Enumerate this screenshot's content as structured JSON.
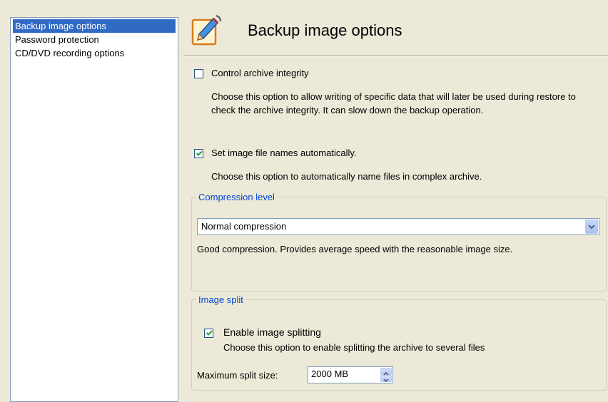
{
  "sidebar": {
    "items": [
      {
        "label": "Backup image options",
        "selected": true
      },
      {
        "label": "Password protection",
        "selected": false
      },
      {
        "label": "CD/DVD recording options",
        "selected": false
      }
    ]
  },
  "header": {
    "title": "Backup image options",
    "icon": "pencil-edit-icon"
  },
  "options": {
    "integrity": {
      "label": "Control archive integrity",
      "checked": false,
      "description": "Choose this option to allow writing of specific data that will later be used during restore to check the archive integrity. It can slow down the backup operation."
    },
    "auto_names": {
      "label": "Set image file names automatically.",
      "checked": true,
      "description": "Choose this option to automatically name files in complex archive."
    }
  },
  "compression": {
    "legend": "Compression level",
    "selected": "Normal compression",
    "description": "Good compression. Provides average speed with the reasonable image size."
  },
  "split": {
    "legend": "Image split",
    "enable_label": "Enable image splitting",
    "enable_checked": true,
    "description": "Choose this option to enable splitting the archive to several files",
    "max_label": "Maximum split size:",
    "max_value": "2000 MB"
  },
  "colors": {
    "selection": "#316ac5",
    "group_legend": "#0046d5",
    "background": "#ece9d8"
  }
}
